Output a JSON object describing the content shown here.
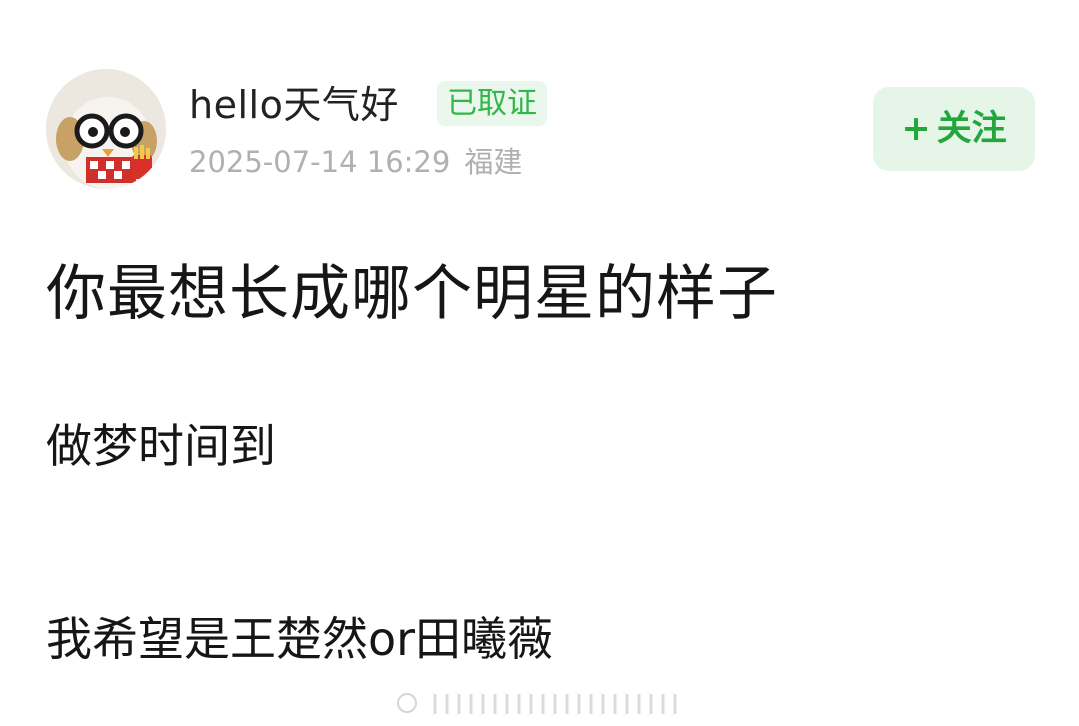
{
  "post": {
    "author": {
      "name": "hello天气好",
      "badge": "已取证"
    },
    "timestamp": "2025-07-14 16:29",
    "location": "福建",
    "follow_label": "关注",
    "follow_plus": "+",
    "title": "你最想长成哪个明星的样子",
    "paragraphs": [
      "做梦时间到",
      "我希望是王楚然or田曦薇"
    ]
  },
  "colors": {
    "accent_green": "#23a73c",
    "badge_bg": "#e9f7ec",
    "meta_gray": "#b0b0b0"
  },
  "icons": {
    "avatar": "plush-duck-with-glasses-avatar",
    "bottom": "faint-lines-indicator-icon"
  }
}
